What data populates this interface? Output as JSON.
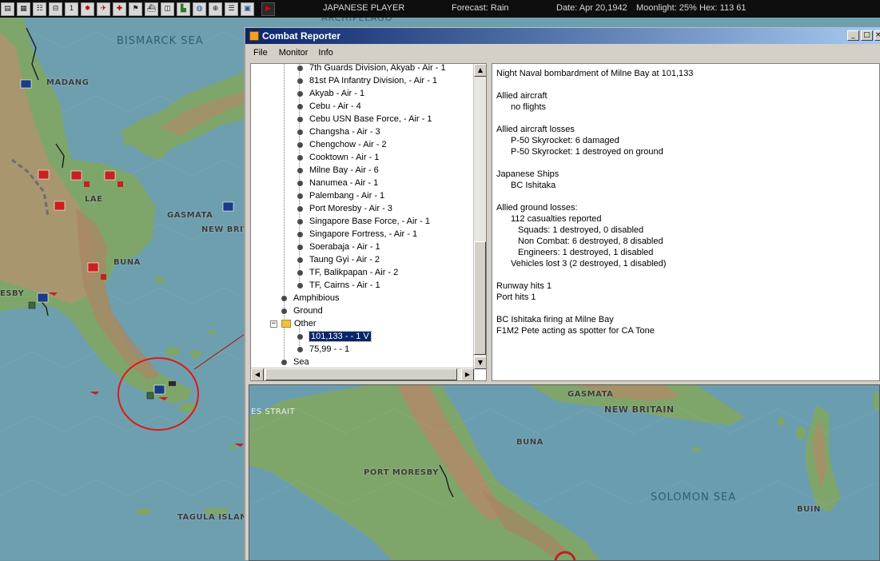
{
  "toolbar": {
    "icons": [
      "save-icon",
      "report-icon",
      "combat-report-icon",
      "intel-icon",
      "info-icon",
      "japanese-flag-icon",
      "aircraft-icon",
      "bomber-icon",
      "flag-icon",
      "ship-icon",
      "chart-icon",
      "map-icon",
      "globe-icon",
      "ob-icon",
      "list-icon",
      "screen-icon",
      "end-turn-icon"
    ],
    "player": "JAPANESE PLAYER",
    "forecast": "Forecast: Rain",
    "date": "Date: Apr 20,1942",
    "moonlight": "Moonlight: 25%",
    "hex": "Hex: 113 61"
  },
  "map_labels": {
    "archipelago": "ARCHIPELAGO",
    "bismarck_sea": "BISMARCK SEA",
    "madang": "MADANG",
    "lae": "LAE",
    "gasmata": "GASMATA",
    "new_britain": "NEW BRIT",
    "buna": "BUNA",
    "esby": "ESBY",
    "tagula_island": "TAGULA ISLAND"
  },
  "window": {
    "title": "Combat Reporter",
    "controls": [
      "_",
      "□",
      "×"
    ],
    "menu": [
      "File",
      "Monitor",
      "Info"
    ]
  },
  "tree": {
    "items": [
      {
        "label": "7th Guards Division, Akyab  - Air - 1",
        "level": 2
      },
      {
        "label": "81st PA Infantry Division,  - Air - 1",
        "level": 2
      },
      {
        "label": "Akyab  - Air - 1",
        "level": 2
      },
      {
        "label": "Cebu  - Air - 4",
        "level": 2
      },
      {
        "label": "Cebu USN Base Force,  - Air - 1",
        "level": 2
      },
      {
        "label": "Changsha  - Air - 3",
        "level": 2
      },
      {
        "label": "Chengchow  - Air - 2",
        "level": 2
      },
      {
        "label": "Cooktown  - Air - 1",
        "level": 2
      },
      {
        "label": "Milne Bay  - Air - 6",
        "level": 2
      },
      {
        "label": "Nanumea  - Air - 1",
        "level": 2
      },
      {
        "label": "Palembang  - Air - 1",
        "level": 2
      },
      {
        "label": "Port Moresby  - Air - 3",
        "level": 2
      },
      {
        "label": "Singapore Base Force,  - Air - 1",
        "level": 2
      },
      {
        "label": "Singapore Fortress,  - Air - 1",
        "level": 2
      },
      {
        "label": "Soerabaja  - Air - 1",
        "level": 2
      },
      {
        "label": "Taung Gyi  - Air - 2",
        "level": 2
      },
      {
        "label": "TF, Balikpapan  - Air - 2",
        "level": 2
      },
      {
        "label": "TF, Cairns  - Air - 1",
        "level": 2
      },
      {
        "label": "Amphibious",
        "level": 1
      },
      {
        "label": "Ground",
        "level": 1
      },
      {
        "label": "Other",
        "level": 1,
        "folder": true,
        "expanded": true
      },
      {
        "label": "101,133 -  - 1 V",
        "level": 2,
        "selected": true
      },
      {
        "label": "75,99 -  - 1",
        "level": 2
      },
      {
        "label": "Sea",
        "level": 1
      }
    ]
  },
  "report": {
    "lines": [
      {
        "text": "Night Naval bombardment of Milne Bay at 101,133",
        "indent": 0
      },
      {
        "text": "",
        "indent": 0
      },
      {
        "text": "Allied aircraft",
        "indent": 0
      },
      {
        "text": "no flights",
        "indent": 1
      },
      {
        "text": "",
        "indent": 0
      },
      {
        "text": "Allied aircraft losses",
        "indent": 0
      },
      {
        "text": "P-50 Skyrocket: 6 damaged",
        "indent": 1
      },
      {
        "text": "P-50 Skyrocket: 1 destroyed on ground",
        "indent": 1
      },
      {
        "text": "",
        "indent": 0
      },
      {
        "text": "Japanese Ships",
        "indent": 0
      },
      {
        "text": "BC Ishitaka",
        "indent": 1
      },
      {
        "text": "",
        "indent": 0
      },
      {
        "text": "Allied ground losses:",
        "indent": 0
      },
      {
        "text": "112 casualties reported",
        "indent": 1
      },
      {
        "text": "Squads: 1 destroyed, 0 disabled",
        "indent": 2
      },
      {
        "text": "Non Combat: 6 destroyed, 8 disabled",
        "indent": 2
      },
      {
        "text": "Engineers: 1 destroyed, 1 disabled",
        "indent": 2
      },
      {
        "text": "Vehicles lost 3 (2 destroyed, 1 disabled)",
        "indent": 1
      },
      {
        "text": "",
        "indent": 0
      },
      {
        "text": "Runway hits 1",
        "indent": 0
      },
      {
        "text": "Port hits 1",
        "indent": 0
      },
      {
        "text": "",
        "indent": 0
      },
      {
        "text": "BC Ishitaka firing at Milne Bay",
        "indent": 0
      },
      {
        "text": "F1M2 Pete acting as spotter for CA Tone",
        "indent": 0
      }
    ]
  },
  "zoom_map": {
    "labels": {
      "strait": "ES STRAIT",
      "gasmata": "GASMATA",
      "new_britain": "NEW BRITAIN",
      "buna": "BUNA",
      "port_moresby": "PORT MORESBY",
      "solomon_sea": "SOLOMON SEA",
      "buin": "BUIN"
    }
  },
  "colors": {
    "sea": "#6a9aa8",
    "land": "#6f9a5e",
    "mountain": "#b08a68",
    "title_bar": "#0a246a",
    "highlight_circle": "#e01818",
    "indicator_line": "#b01010"
  }
}
